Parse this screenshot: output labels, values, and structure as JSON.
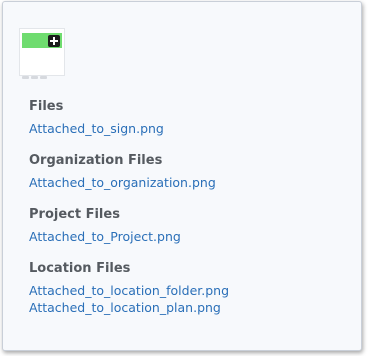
{
  "thumbnail": {
    "icon": "plus-icon"
  },
  "sections": [
    {
      "title": "Files",
      "files": [
        "Attached_to_sign.png"
      ]
    },
    {
      "title": "Organization Files",
      "files": [
        "Attached_to_organization.png"
      ]
    },
    {
      "title": "Project Files",
      "files": [
        "Attached_to_Project.png"
      ]
    },
    {
      "title": "Location Files",
      "files": [
        "Attached_to_location_folder.png",
        "Attached_to_location_plan.png"
      ]
    }
  ],
  "colors": {
    "link": "#2a6fb8",
    "heading": "#555a60",
    "panel_bg": "#f7f9fc",
    "thumb_accent": "#6fdc6f"
  }
}
